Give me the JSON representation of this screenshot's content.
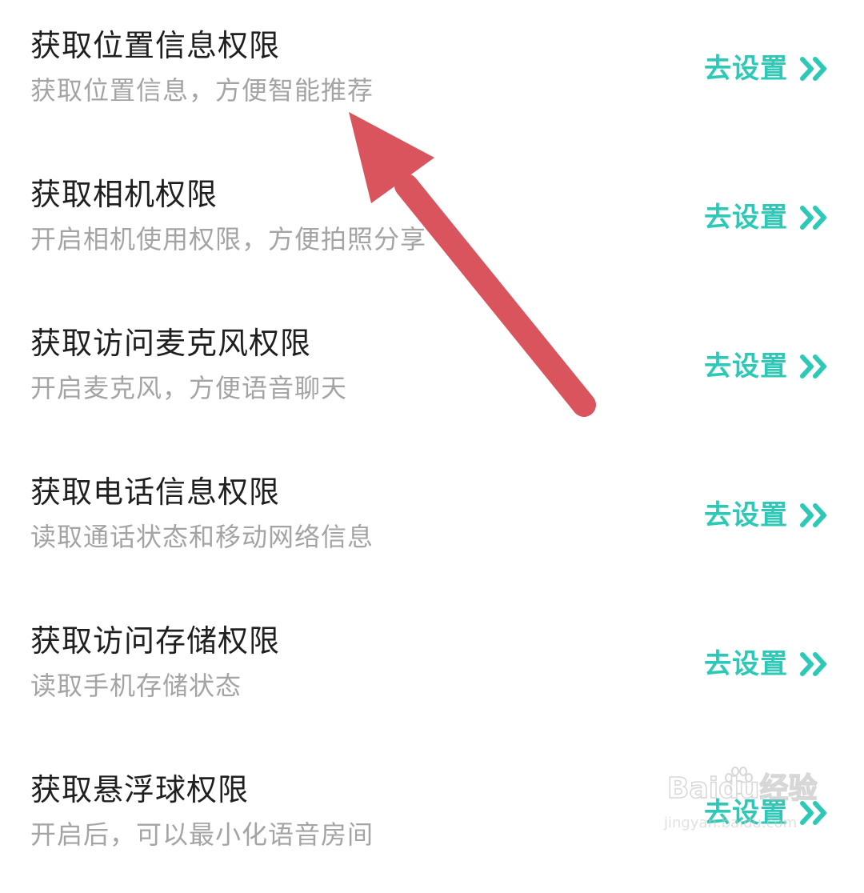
{
  "permissions": [
    {
      "title": "获取位置信息权限",
      "description": "获取位置信息，方便智能推荐",
      "action": "去设置"
    },
    {
      "title": "获取相机权限",
      "description": "开启相机使用权限，方便拍照分享",
      "action": "去设置"
    },
    {
      "title": "获取访问麦克风权限",
      "description": "开启麦克风，方便语音聊天",
      "action": "去设置"
    },
    {
      "title": "获取电话信息权限",
      "description": "读取通话状态和移动网络信息",
      "action": "去设置"
    },
    {
      "title": "获取访问存储权限",
      "description": "读取手机存储状态",
      "action": "去设置"
    },
    {
      "title": "获取悬浮球权限",
      "description": "开启后，可以最小化语音房间",
      "action": "去设置"
    }
  ],
  "icons": {
    "action_chevron": "double-chevron-right-icon",
    "annotation": "red-arrow-annotation"
  },
  "watermark": {
    "logo": "Baidu经验",
    "url": "jingyan.baidu.com"
  },
  "colors": {
    "accent": "#2ec9b6",
    "title": "#1f1f1f",
    "description": "#a4a4a4",
    "annotation_arrow": "#d9545c"
  }
}
